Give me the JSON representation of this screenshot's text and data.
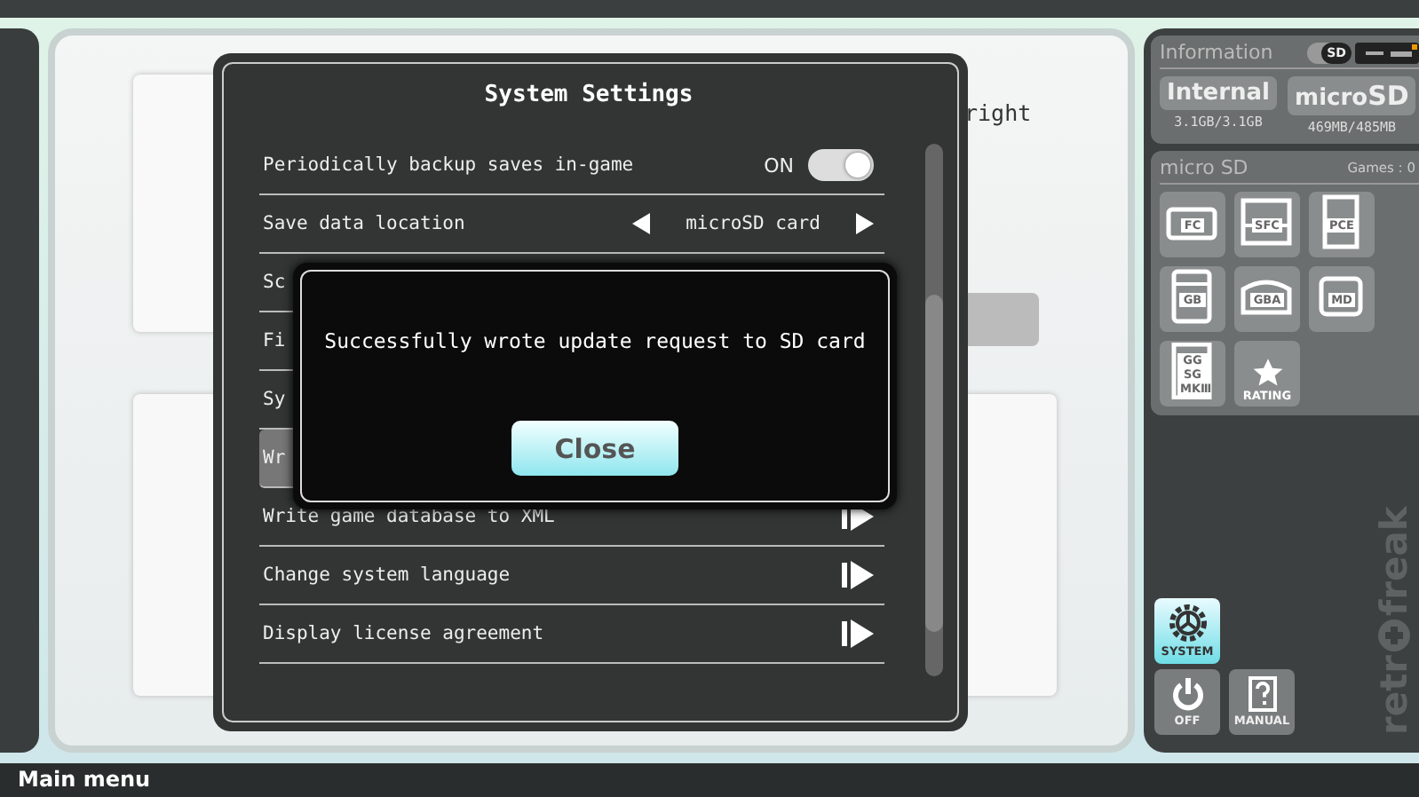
{
  "main_area": {
    "instruction": "right"
  },
  "system_settings": {
    "title": "System Settings",
    "rows": [
      {
        "label": "Periodically backup saves in-game",
        "kind": "toggle",
        "value": "ON",
        "on": true,
        "selected": false
      },
      {
        "label": "Save data location",
        "kind": "choice",
        "value": "microSD card",
        "selected": false
      },
      {
        "label": "Sc",
        "kind": "covered",
        "selected": false
      },
      {
        "label": "Fi",
        "kind": "covered",
        "selected": false
      },
      {
        "label": "Sy",
        "kind": "covered",
        "selected": false
      },
      {
        "label": "Wr",
        "kind": "covered",
        "selected": true
      },
      {
        "label": "Write game database to XML",
        "kind": "link",
        "selected": false
      },
      {
        "label": "Change system language",
        "kind": "link",
        "selected": false
      },
      {
        "label": "Display license agreement",
        "kind": "link",
        "selected": false
      }
    ]
  },
  "message_dialog": {
    "message": "Successfully wrote update request to SD card",
    "button": "Close"
  },
  "info_panel": {
    "title": "Information",
    "sd_badge": "SD",
    "storage": [
      {
        "label": "Internal",
        "usage": "3.1GB/3.1GB"
      },
      {
        "label": "micro**SD**",
        "usage": "469MB/485MB"
      }
    ]
  },
  "library": {
    "title": "micro SD",
    "count": "Games : 0",
    "platforms": [
      {
        "label": "FC",
        "kind": "cart"
      },
      {
        "label": "SFC",
        "kind": "snes"
      },
      {
        "label": "PCE",
        "kind": "card"
      },
      {
        "label": "GB",
        "kind": "handheld"
      },
      {
        "label": "GBA",
        "kind": "gba"
      },
      {
        "label": "MD",
        "kind": "md"
      },
      {
        "label": "GG SG MKⅢ",
        "kind": "tall"
      },
      {
        "label": "RATING",
        "kind": "rating"
      }
    ]
  },
  "side_buttons": [
    {
      "label": "SYSTEM",
      "kind": "gear",
      "selected": true
    },
    {
      "label": "OFF",
      "kind": "power",
      "selected": false
    },
    {
      "label": "MANUAL",
      "kind": "manual",
      "selected": false
    }
  ],
  "logo": {
    "first": "retr",
    "second": "freak"
  },
  "status_bar": {
    "title": "Main menu"
  }
}
